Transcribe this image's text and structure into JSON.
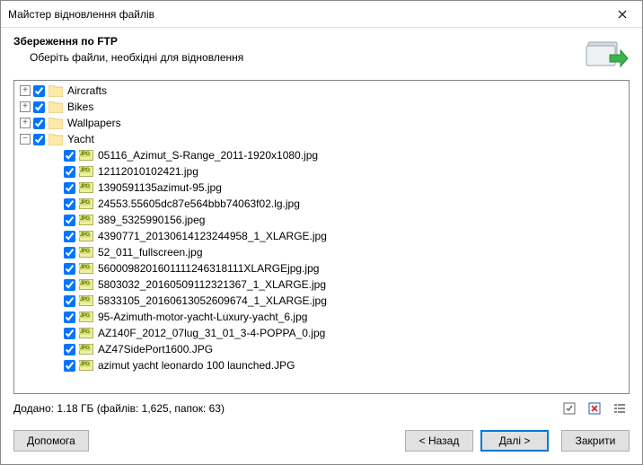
{
  "titlebar": {
    "title": "Майстер відновлення файлів"
  },
  "header": {
    "heading": "Збереження по FTP",
    "sub": "Оберіть файли, необхідні для відновлення"
  },
  "tree": {
    "folders": [
      {
        "expander": "+",
        "label": "Aircrafts",
        "indent": 0
      },
      {
        "expander": "+",
        "label": "Bikes",
        "indent": 0
      },
      {
        "expander": "+",
        "label": "Wallpapers",
        "indent": 0
      },
      {
        "expander": "−",
        "label": "Yacht",
        "indent": 0
      }
    ],
    "files": [
      {
        "label": "05116_Azimut_S-Range_2011-1920x1080.jpg"
      },
      {
        "label": "12112010102421.jpg"
      },
      {
        "label": "1390591135azimut-95.jpg"
      },
      {
        "label": "24553.55605dc87e564bbb74063f02.lg.jpg"
      },
      {
        "label": "389_5325990156.jpeg"
      },
      {
        "label": "4390771_20130614123244958_1_XLARGE.jpg"
      },
      {
        "label": "52_011_fullscreen.jpg"
      },
      {
        "label": "5600098201601111246318111XLARGEjpg.jpg"
      },
      {
        "label": "5803032_20160509112321367_1_XLARGE.jpg"
      },
      {
        "label": "5833105_20160613052609674_1_XLARGE.jpg"
      },
      {
        "label": "95-Azimuth-motor-yacht-Luxury-yacht_6.jpg"
      },
      {
        "label": "AZ140F_2012_07lug_31_01_3-4-POPPA_0.jpg"
      },
      {
        "label": "AZ47SidePort1600.JPG"
      },
      {
        "label": "azimut yacht leonardo 100 launched.JPG"
      }
    ]
  },
  "stats": "Додано: 1.18 ГБ (файлів: 1,625, папок: 63)",
  "buttons": {
    "help": "Допомога",
    "back": "< Назад",
    "next": "Далі >",
    "close": "Закрити"
  }
}
